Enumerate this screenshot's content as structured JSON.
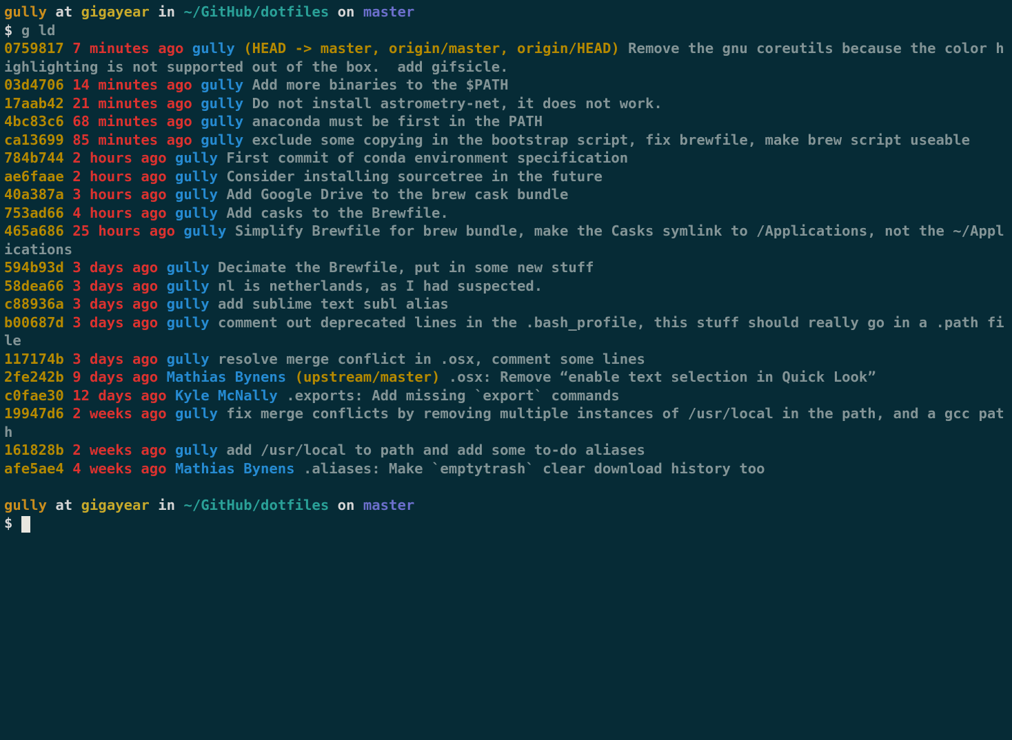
{
  "prompt1": {
    "user": "gully",
    "at": "at",
    "host": "gigayear",
    "in": "in",
    "path": "~/GitHub/dotfiles",
    "on": "on",
    "branch": "master",
    "symbol": "$",
    "command": "g ld"
  },
  "commits": [
    {
      "hash": "0759817",
      "age": "7 minutes ago",
      "author": "gully",
      "refs": "(HEAD -> master, origin/master, origin/HEAD)",
      "msg": "Remove the gnu coreutils because the color highlighting is not supported out of the box.  add gifsicle."
    },
    {
      "hash": "03d4706",
      "age": "14 minutes ago",
      "author": "gully",
      "refs": "",
      "msg": "Add more binaries to the $PATH"
    },
    {
      "hash": "17aab42",
      "age": "21 minutes ago",
      "author": "gully",
      "refs": "",
      "msg": "Do not install astrometry-net, it does not work."
    },
    {
      "hash": "4bc83c6",
      "age": "68 minutes ago",
      "author": "gully",
      "refs": "",
      "msg": "anaconda must be first in the PATH"
    },
    {
      "hash": "ca13699",
      "age": "85 minutes ago",
      "author": "gully",
      "refs": "",
      "msg": "exclude some copying in the bootstrap script, fix brewfile, make brew script useable"
    },
    {
      "hash": "784b744",
      "age": "2 hours ago",
      "author": "gully",
      "refs": "",
      "msg": "First commit of conda environment specification"
    },
    {
      "hash": "ae6faae",
      "age": "2 hours ago",
      "author": "gully",
      "refs": "",
      "msg": "Consider installing sourcetree in the future"
    },
    {
      "hash": "40a387a",
      "age": "3 hours ago",
      "author": "gully",
      "refs": "",
      "msg": "Add Google Drive to the brew cask bundle"
    },
    {
      "hash": "753ad66",
      "age": "4 hours ago",
      "author": "gully",
      "refs": "",
      "msg": "Add casks to the Brewfile."
    },
    {
      "hash": "465a686",
      "age": "25 hours ago",
      "author": "gully",
      "refs": "",
      "msg": "Simplify Brewfile for brew bundle, make the Casks symlink to /Applications, not the ~/Applications"
    },
    {
      "hash": "594b93d",
      "age": "3 days ago",
      "author": "gully",
      "refs": "",
      "msg": "Decimate the Brewfile, put in some new stuff"
    },
    {
      "hash": "58dea66",
      "age": "3 days ago",
      "author": "gully",
      "refs": "",
      "msg": "nl is netherlands, as I had suspected."
    },
    {
      "hash": "c88936a",
      "age": "3 days ago",
      "author": "gully",
      "refs": "",
      "msg": "add sublime text subl alias"
    },
    {
      "hash": "b00687d",
      "age": "3 days ago",
      "author": "gully",
      "refs": "",
      "msg": "comment out deprecated lines in the .bash_profile, this stuff should really go in a .path file"
    },
    {
      "hash": "117174b",
      "age": "3 days ago",
      "author": "gully",
      "refs": "",
      "msg": "resolve merge conflict in .osx, comment some lines"
    },
    {
      "hash": "2fe242b",
      "age": "9 days ago",
      "author": "Mathias Bynens",
      "refs": "(upstream/master)",
      "msg": ".osx: Remove “enable text selection in Quick Look”"
    },
    {
      "hash": "c0fae30",
      "age": "12 days ago",
      "author": "Kyle McNally",
      "refs": "",
      "msg": ".exports: Add missing `export` commands"
    },
    {
      "hash": "19947d6",
      "age": "2 weeks ago",
      "author": "gully",
      "refs": "",
      "msg": "fix merge conflicts by removing multiple instances of /usr/local in the path, and a gcc path"
    },
    {
      "hash": "161828b",
      "age": "2 weeks ago",
      "author": "gully",
      "refs": "",
      "msg": "add /usr/local to path and add some to-do aliases"
    },
    {
      "hash": "afe5ae4",
      "age": "4 weeks ago",
      "author": "Mathias Bynens",
      "refs": "",
      "msg": ".aliases: Make `emptytrash` clear download history too"
    }
  ],
  "prompt2": {
    "user": "gully",
    "at": "at",
    "host": "gigayear",
    "in": "in",
    "path": "~/GitHub/dotfiles",
    "on": "on",
    "branch": "master",
    "symbol": "$"
  }
}
